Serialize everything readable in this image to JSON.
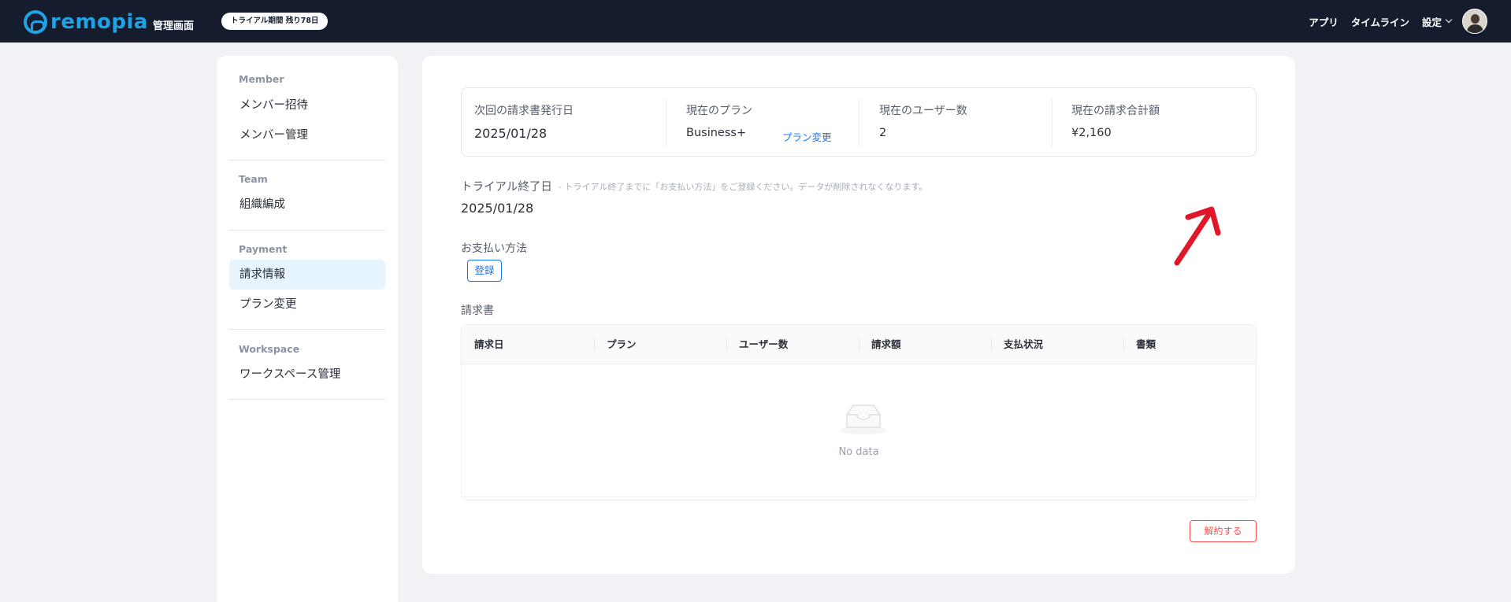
{
  "header": {
    "logo_text": "remopia",
    "logo_sub": "管理画面",
    "trial_badge": "トライアル期間 残り78日",
    "nav": {
      "app": "アプリ",
      "timeline": "タイムライン",
      "settings": "設定"
    }
  },
  "sidebar": {
    "sections": [
      {
        "title": "Member",
        "items": [
          "メンバー招待",
          "メンバー管理"
        ]
      },
      {
        "title": "Team",
        "items": [
          "組織編成"
        ]
      },
      {
        "title": "Payment",
        "items": [
          "請求情報",
          "プラン変更"
        ]
      },
      {
        "title": "Workspace",
        "items": [
          "ワークスペース管理"
        ]
      }
    ],
    "active_item": "請求情報"
  },
  "summary": {
    "next_invoice_label": "次回の請求書発行日",
    "next_invoice_value": "2025/01/28",
    "plan_label": "現在のプラン",
    "plan_value": "Business+",
    "plan_change_link": "プラン変更",
    "users_label": "現在のユーザー数",
    "users_value": "2",
    "total_label": "現在の請求合計額",
    "total_value": "¥2,160"
  },
  "trial": {
    "label": "トライアル終了日",
    "note": "- トライアル終了までに「お支払い方法」をご登録ください。データが削除されなくなります。",
    "date": "2025/01/28"
  },
  "payment": {
    "label": "お支払い方法",
    "register_button": "登録"
  },
  "invoices": {
    "label": "請求書",
    "columns": [
      "請求日",
      "プラン",
      "ユーザー数",
      "請求額",
      "支払状況",
      "書類"
    ],
    "empty_text": "No data"
  },
  "cancel_button": "解約する",
  "colors": {
    "header_bg": "#141c2e",
    "brand": "#1fa3e6",
    "link": "#1677ff",
    "danger": "#ff4d4f",
    "annotation": "#e0162b"
  }
}
